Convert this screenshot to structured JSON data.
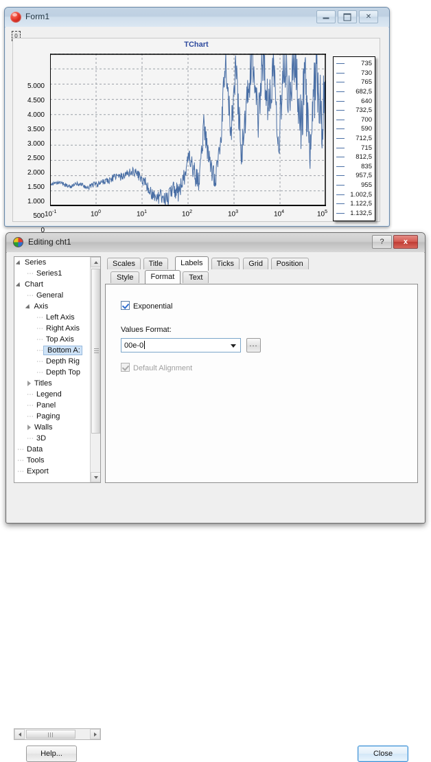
{
  "form_window": {
    "title": "Form1",
    "icon": "delphi-app-icon",
    "buttons": {
      "minimize": "minimize",
      "maximize": "maximize",
      "close": "close"
    }
  },
  "chart": {
    "title": "TChart",
    "legend_entries": [
      "735",
      "730",
      "765",
      "682,5",
      "640",
      "732,5",
      "700",
      "590",
      "712,5",
      "715",
      "812,5",
      "835",
      "957,5",
      "955",
      "1.002,5",
      "1.122,5",
      "1.132,5"
    ]
  },
  "chart_data": {
    "type": "line",
    "title": "TChart",
    "xlabel": "",
    "ylabel": "",
    "xscale": "log",
    "xlim": [
      0.1,
      100000
    ],
    "ylim": [
      0,
      5000
    ],
    "ytick_labels": [
      "5.000",
      "4.500",
      "4.000",
      "3.500",
      "3.000",
      "2.500",
      "2.000",
      "1.500",
      "1.000",
      "500",
      "0"
    ],
    "ytick_values": [
      5000,
      4500,
      4000,
      3500,
      3000,
      2500,
      2000,
      1500,
      1000,
      500,
      0
    ],
    "xtick_labels": [
      "10-1",
      "100",
      "101",
      "102",
      "103",
      "104",
      "105"
    ],
    "xtick_bases": [
      "10",
      "10",
      "10",
      "10",
      "10",
      "10",
      "10"
    ],
    "xtick_exponents": [
      "-1",
      "0",
      "1",
      "2",
      "3",
      "4",
      "5"
    ],
    "xtick_values": [
      0.1,
      1,
      10,
      100,
      1000,
      10000,
      100000
    ],
    "grid": true,
    "legend_position": "right",
    "legend": [
      "735",
      "730",
      "765",
      "682,5",
      "640",
      "732,5",
      "700",
      "590",
      "712,5",
      "715",
      "812,5",
      "835",
      "957,5",
      "955",
      "1.002,5",
      "1.122,5",
      "1.132,5"
    ],
    "series": [
      {
        "name": "Series1",
        "color": "#4a6fa5",
        "x": [
          0.1,
          0.13,
          0.17,
          0.22,
          0.29,
          0.38,
          0.5,
          0.65,
          0.85,
          1.1,
          1.45,
          1.9,
          2.5,
          3.3,
          4.3,
          5.6,
          7.3,
          9.5,
          12,
          16,
          21,
          27,
          35,
          46,
          60,
          78,
          100,
          130,
          170,
          220,
          290,
          380,
          500,
          650,
          850,
          1100,
          1450,
          1900,
          2500,
          3300,
          4300,
          5600,
          7300,
          9500,
          12000,
          16000,
          21000,
          27000,
          35000,
          46000,
          60000,
          78000,
          100000
        ],
        "y": [
          735,
          730,
          765,
          683,
          640,
          733,
          700,
          590,
          713,
          715,
          813,
          835,
          958,
          955,
          1003,
          1123,
          1133,
          900,
          760,
          430,
          250,
          330,
          180,
          660,
          420,
          810,
          1550,
          1200,
          690,
          2600,
          1420,
          980,
          1700,
          4900,
          2350,
          4600,
          1650,
          3300,
          5000,
          2700,
          4950,
          3100,
          4800,
          2100,
          5000,
          3600,
          4900,
          2450,
          4100,
          1350,
          4700,
          2900,
          3500
        ]
      }
    ]
  },
  "editor_window": {
    "title": "Editing cht1",
    "icon": "chart-editor-icon",
    "help_btn": "?",
    "close_btn": "x"
  },
  "tree": {
    "items": [
      {
        "label": "Series",
        "level": 0,
        "twisty": "expanded",
        "selected": false
      },
      {
        "label": "Series1",
        "level": 1,
        "twisty": "leaf",
        "selected": false
      },
      {
        "label": "Chart",
        "level": 0,
        "twisty": "expanded",
        "selected": false
      },
      {
        "label": "General",
        "level": 1,
        "twisty": "leaf",
        "selected": false
      },
      {
        "label": "Axis",
        "level": 1,
        "twisty": "expanded",
        "selected": false
      },
      {
        "label": "Left Axis",
        "level": 2,
        "twisty": "leaf",
        "selected": false
      },
      {
        "label": "Right Axis",
        "level": 2,
        "twisty": "leaf",
        "selected": false
      },
      {
        "label": "Top Axis",
        "level": 2,
        "twisty": "leaf",
        "selected": false
      },
      {
        "label": "Bottom A:",
        "level": 2,
        "twisty": "leaf",
        "selected": true
      },
      {
        "label": "Depth Rig",
        "level": 2,
        "twisty": "leaf",
        "selected": false
      },
      {
        "label": "Depth Top",
        "level": 2,
        "twisty": "leaf",
        "selected": false
      },
      {
        "label": "Titles",
        "level": 1,
        "twisty": "collapsed",
        "selected": false
      },
      {
        "label": "Legend",
        "level": 1,
        "twisty": "leaf",
        "selected": false
      },
      {
        "label": "Panel",
        "level": 1,
        "twisty": "leaf",
        "selected": false
      },
      {
        "label": "Paging",
        "level": 1,
        "twisty": "leaf",
        "selected": false
      },
      {
        "label": "Walls",
        "level": 1,
        "twisty": "collapsed",
        "selected": false
      },
      {
        "label": "3D",
        "level": 1,
        "twisty": "leaf",
        "selected": false
      },
      {
        "label": "Data",
        "level": 0,
        "twisty": "leaf",
        "selected": false
      },
      {
        "label": "Tools",
        "level": 0,
        "twisty": "leaf",
        "selected": false
      },
      {
        "label": "Export",
        "level": 0,
        "twisty": "leaf",
        "selected": false
      }
    ]
  },
  "tabs": {
    "main": [
      {
        "label": "Scales",
        "active": false
      },
      {
        "label": "Title",
        "active": false
      },
      {
        "label": "Labels",
        "active": true
      },
      {
        "label": "Ticks",
        "active": false
      },
      {
        "label": "Grid",
        "active": false
      },
      {
        "label": "Position",
        "active": false
      }
    ],
    "sub": [
      {
        "label": "Style",
        "active": false
      },
      {
        "label": "Format",
        "active": true
      },
      {
        "label": "Text",
        "active": false
      }
    ]
  },
  "form": {
    "exponential_label": "Exponential",
    "exponential_checked": true,
    "values_format_label": "Values Format:",
    "values_format_value": "00e-0",
    "ellipsis_button": "...",
    "default_alignment_label": "Default Alignment",
    "default_alignment_checked": true,
    "default_alignment_disabled": true
  },
  "footer": {
    "help_label": "Help...",
    "close_label": "Close"
  }
}
